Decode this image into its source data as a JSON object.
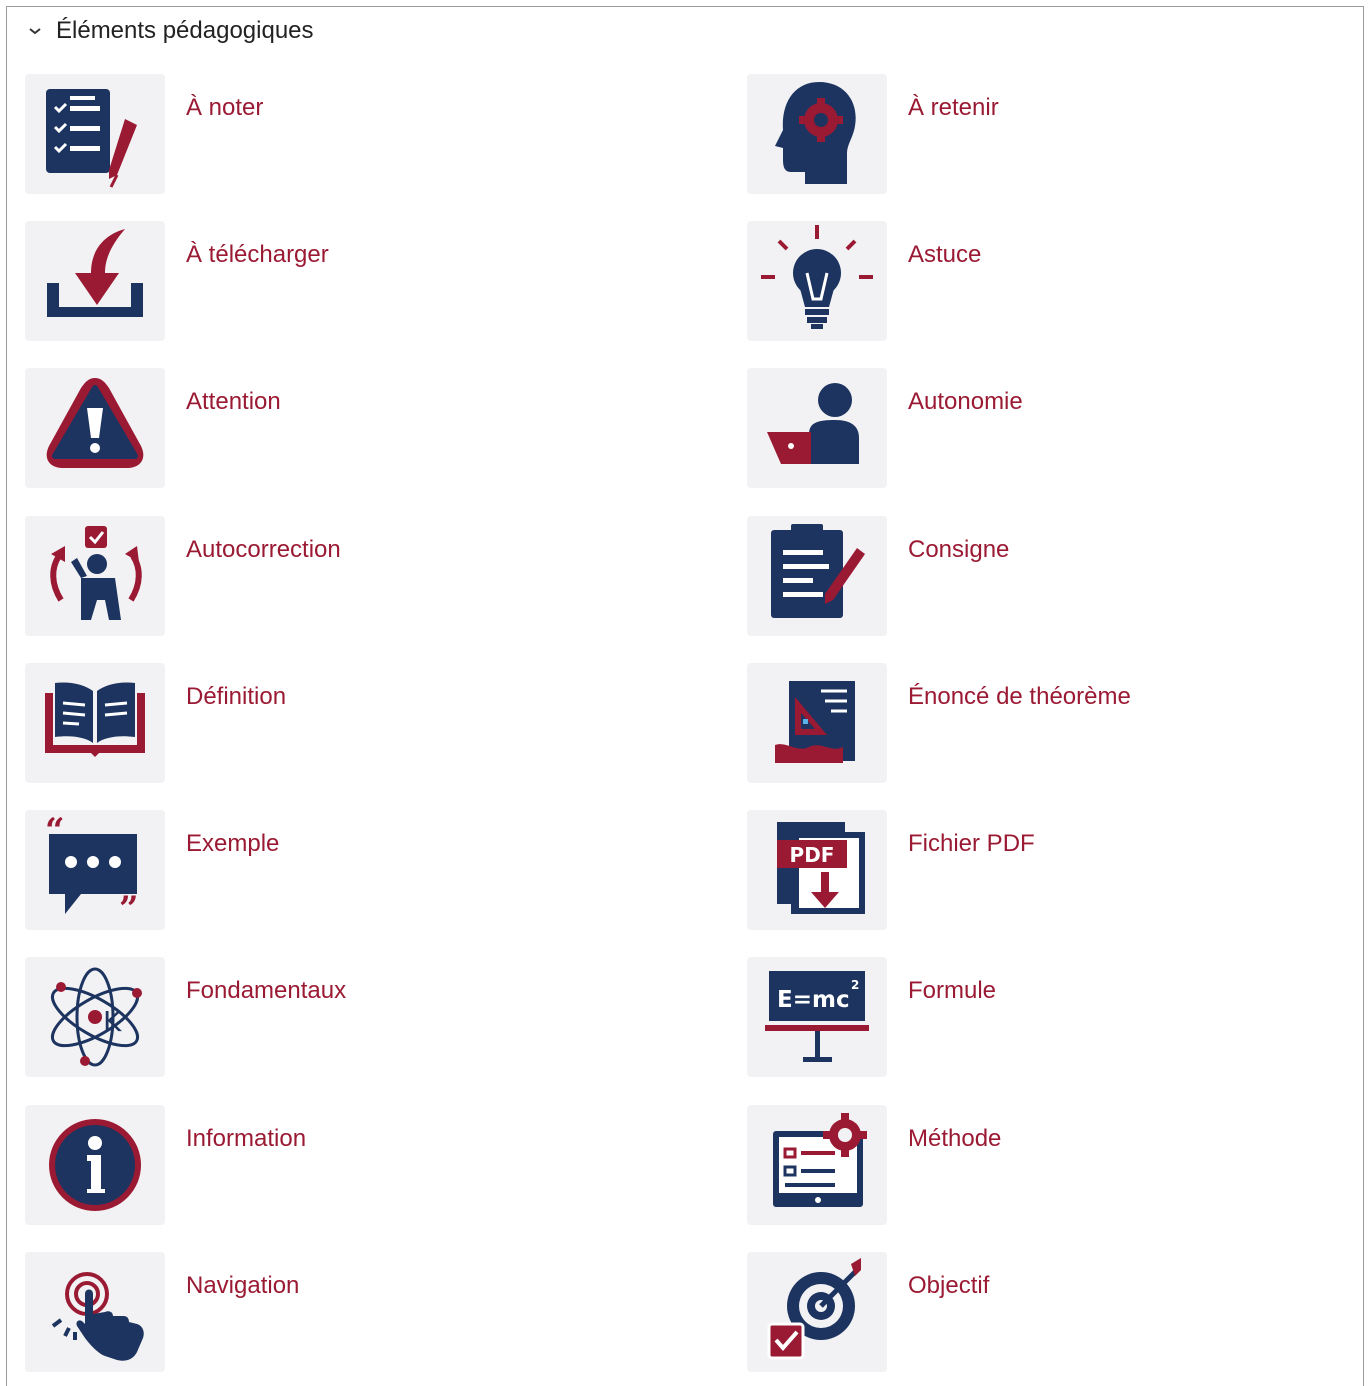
{
  "section": {
    "title": "Éléments pédagogiques",
    "chevron_icon": "chevron-down-icon"
  },
  "colors": {
    "navy": "#1c345f",
    "crimson": "#9b1a33",
    "tile_bg": "#f2f2f4",
    "label_text": "#9b1a33"
  },
  "items": [
    {
      "label": "À noter",
      "icon": "checklist-pen-icon"
    },
    {
      "label": "À retenir",
      "icon": "head-gear-icon"
    },
    {
      "label": "À télécharger",
      "icon": "download-tray-icon"
    },
    {
      "label": "Astuce",
      "icon": "lightbulb-icon"
    },
    {
      "label": "Attention",
      "icon": "warning-triangle-icon"
    },
    {
      "label": "Autonomie",
      "icon": "person-laptop-icon"
    },
    {
      "label": "Autocorrection",
      "icon": "self-check-person-icon"
    },
    {
      "label": "Consigne",
      "icon": "clipboard-pen-icon"
    },
    {
      "label": "Définition",
      "icon": "open-book-icon"
    },
    {
      "label": "Énoncé de théorème",
      "icon": "geometry-document-icon"
    },
    {
      "label": "Exemple",
      "icon": "speech-bubble-quotes-icon"
    },
    {
      "label": "Fichier PDF",
      "icon": "pdf-download-icon"
    },
    {
      "label": "Fondamentaux",
      "icon": "atom-k-icon"
    },
    {
      "label": "Formule",
      "icon": "formula-board-icon"
    },
    {
      "label": "Information",
      "icon": "info-circle-icon"
    },
    {
      "label": "Méthode",
      "icon": "method-screen-gear-icon"
    },
    {
      "label": "Navigation",
      "icon": "hand-pointer-icon"
    },
    {
      "label": "Objectif",
      "icon": "target-arrow-check-icon"
    }
  ]
}
